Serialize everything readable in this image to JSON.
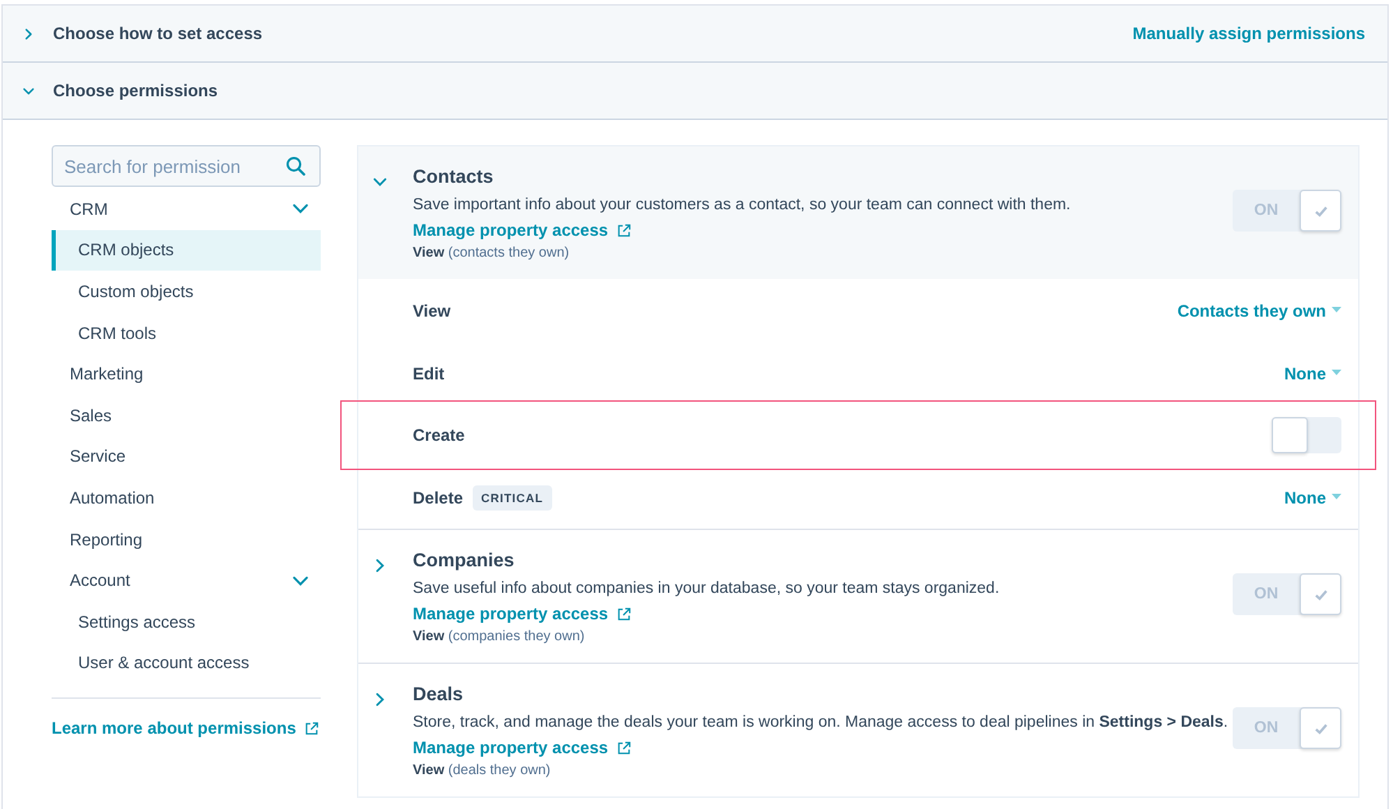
{
  "sections": [
    {
      "title": "Choose how to set access",
      "expanded": false,
      "action": "Manually assign permissions"
    },
    {
      "title": "Choose permissions",
      "expanded": true
    }
  ],
  "search": {
    "placeholder": "Search for permission"
  },
  "sidebar": {
    "items": [
      {
        "label": "CRM",
        "selected": false,
        "expanded": true,
        "children": [
          {
            "label": "CRM objects",
            "selected": true
          },
          {
            "label": "Custom objects",
            "selected": false
          },
          {
            "label": "CRM tools",
            "selected": false
          }
        ]
      },
      {
        "label": "Marketing",
        "selected": false
      },
      {
        "label": "Sales",
        "selected": false
      },
      {
        "label": "Service",
        "selected": false
      },
      {
        "label": "Automation",
        "selected": false
      },
      {
        "label": "Reporting",
        "selected": false
      },
      {
        "label": "Account",
        "selected": false,
        "expanded": true,
        "children": [
          {
            "label": "Settings access",
            "selected": false
          },
          {
            "label": "User & account access",
            "selected": false
          }
        ]
      }
    ],
    "learn_more": "Learn more about permissions"
  },
  "objects": [
    {
      "title": "Contacts",
      "expanded": true,
      "description": "Save important info about your customers as a contact, so your team can connect with them.",
      "link": "Manage property access",
      "summary_label": "View",
      "summary_value": "(contacts they own)",
      "toggle": {
        "label": "ON",
        "on": true
      },
      "permissions": [
        {
          "label": "View",
          "kind": "dropdown",
          "value": "Contacts they own",
          "highlighted": false
        },
        {
          "label": "Edit",
          "kind": "dropdown",
          "value": "None",
          "highlighted": false
        },
        {
          "label": "Create",
          "kind": "switch",
          "on": false,
          "highlighted": true
        },
        {
          "label": "Delete",
          "badge": "CRITICAL",
          "kind": "dropdown",
          "value": "None",
          "highlighted": false
        }
      ]
    },
    {
      "title": "Companies",
      "expanded": false,
      "description": "Save useful info about companies in your database, so your team stays organized.",
      "link": "Manage property access",
      "summary_label": "View",
      "summary_value": "(companies they own)",
      "toggle": {
        "label": "ON",
        "on": true
      }
    },
    {
      "title": "Deals",
      "expanded": false,
      "description": "Store, track, and manage the deals your team is working on. Manage access to deal pipelines in **Settings > Deals**.",
      "link": "Manage property access",
      "summary_label": "View",
      "summary_value": "(deals they own)",
      "toggle": {
        "label": "ON",
        "on": true
      }
    }
  ]
}
